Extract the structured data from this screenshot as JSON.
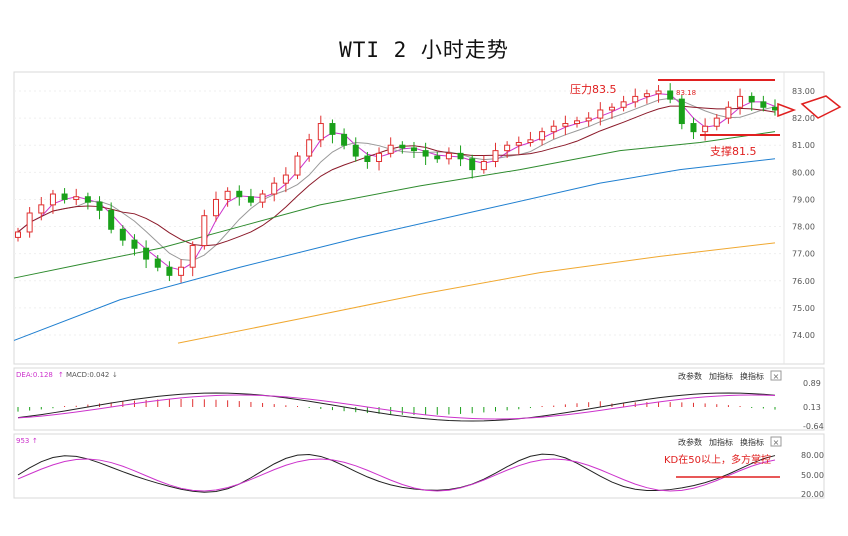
{
  "title": "WTI 2 小时走势",
  "main_panel": {
    "y_ticks": [
      "83.00",
      "82.00",
      "81.00",
      "80.00",
      "79.00",
      "78.00",
      "77.00",
      "76.00",
      "75.00",
      "74.00"
    ],
    "annotations": {
      "resistance": "压力83.5",
      "support": "支撑81.5",
      "high_marker": "83.18"
    }
  },
  "macd_panel": {
    "dea_label": "DEA:0.128",
    "macd_label": "MACD:0.042",
    "buttons": [
      "改参数",
      "加指标",
      "换指标"
    ],
    "close": "×",
    "y_ticks": [
      "0.89",
      "0.13",
      "-0.64"
    ]
  },
  "kd_panel": {
    "label": "953",
    "buttons": [
      "改参数",
      "加指标",
      "换指标"
    ],
    "close": "×",
    "annotation": "KD在50以上，多方掌控",
    "y_ticks": [
      "80.00",
      "50.00",
      "20.00"
    ]
  },
  "colors": {
    "up": "#e03030",
    "down": "#1aa01a",
    "ma_magenta": "#cc33cc",
    "ma_darkred": "#8b1a2a",
    "ma_green": "#2e8b2e",
    "ma_blue": "#1f7fd0",
    "ma_orange": "#f0a830",
    "annotation_red": "#e02020"
  },
  "chart_data": {
    "type": "candlestick",
    "title": "WTI 2 小时走势",
    "ylim": [
      73.5,
      83.3
    ],
    "closes": [
      77.8,
      78.5,
      78.8,
      79.2,
      79.0,
      79.1,
      78.9,
      78.6,
      77.9,
      77.5,
      77.2,
      76.8,
      76.5,
      76.2,
      76.5,
      77.3,
      78.4,
      79.0,
      79.3,
      79.1,
      78.9,
      79.2,
      79.6,
      79.9,
      80.6,
      81.2,
      81.8,
      81.4,
      81.0,
      80.6,
      80.4,
      80.7,
      81.0,
      80.9,
      80.8,
      80.6,
      80.5,
      80.7,
      80.5,
      80.1,
      80.4,
      80.8,
      81.0,
      81.1,
      81.2,
      81.5,
      81.7,
      81.8,
      81.9,
      82.0,
      82.3,
      82.4,
      82.6,
      82.8,
      82.9,
      83.0,
      82.7,
      81.8,
      81.5,
      81.7,
      82.0,
      82.4,
      82.8,
      82.6,
      82.4,
      82.3
    ]
  }
}
